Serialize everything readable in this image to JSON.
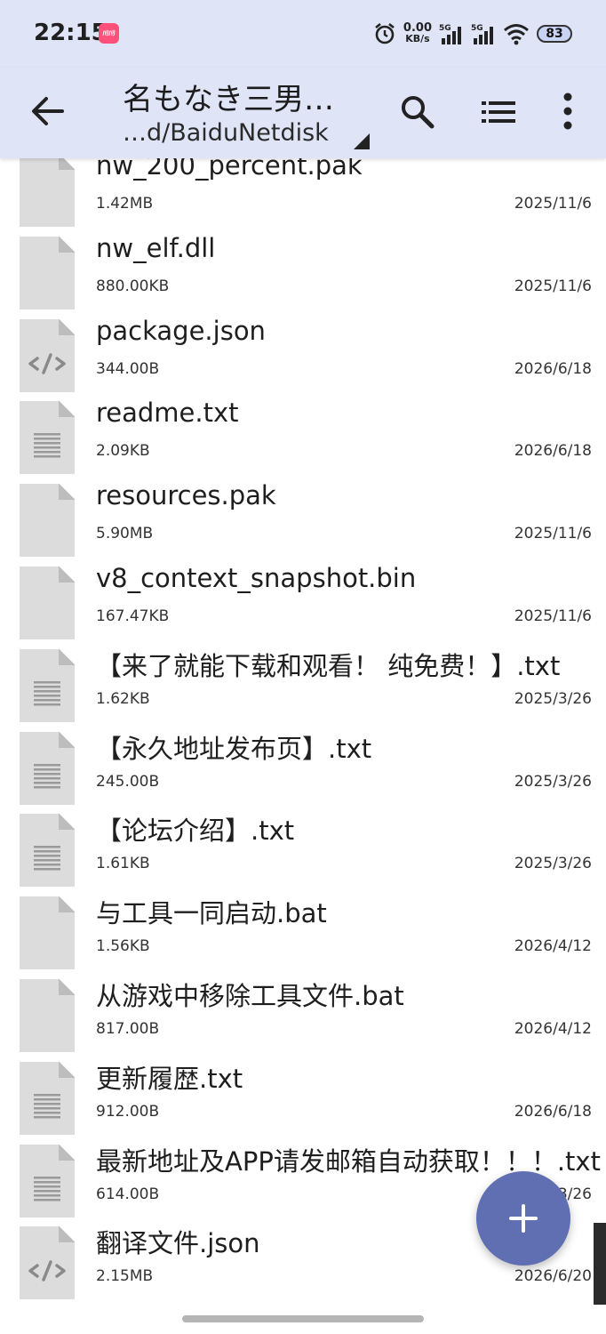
{
  "status_bar": {
    "time": "22:15",
    "app_badge": "ﾊﾘﾊﾘ",
    "net_speed_value": "0.00",
    "net_speed_unit": "KB/s",
    "signal_1_label": "5G",
    "signal_2_label": "5G",
    "battery": "83"
  },
  "toolbar": {
    "title": "名もなき三男…",
    "path": "…d/BaiduNetdisk"
  },
  "files": [
    {
      "name": "nw_200_percent.pak",
      "size": "1.42MB",
      "date": "2025/11/6",
      "icon": "file-generic-icon"
    },
    {
      "name": "nw_elf.dll",
      "size": "880.00KB",
      "date": "2025/11/6",
      "icon": "file-generic-icon"
    },
    {
      "name": "package.json",
      "size": "344.00B",
      "date": "2026/6/18",
      "icon": "file-code-icon"
    },
    {
      "name": "readme.txt",
      "size": "2.09KB",
      "date": "2026/6/18",
      "icon": "file-text-icon"
    },
    {
      "name": "resources.pak",
      "size": "5.90MB",
      "date": "2025/11/6",
      "icon": "file-generic-icon"
    },
    {
      "name": "v8_context_snapshot.bin",
      "size": "167.47KB",
      "date": "2025/11/6",
      "icon": "file-generic-icon"
    },
    {
      "name": "【来了就能下载和观看！ 纯免费！】.txt",
      "size": "1.62KB",
      "date": "2025/3/26",
      "icon": "file-text-icon"
    },
    {
      "name": "【永久地址发布页】.txt",
      "size": "245.00B",
      "date": "2025/3/26",
      "icon": "file-text-icon"
    },
    {
      "name": "【论坛介绍】.txt",
      "size": "1.61KB",
      "date": "2025/3/26",
      "icon": "file-text-icon"
    },
    {
      "name": "与工具一同启动.bat",
      "size": "1.56KB",
      "date": "2026/4/12",
      "icon": "file-generic-icon"
    },
    {
      "name": "从游戏中移除工具文件.bat",
      "size": "817.00B",
      "date": "2026/4/12",
      "icon": "file-generic-icon"
    },
    {
      "name": "更新履歴.txt",
      "size": "912.00B",
      "date": "2026/6/18",
      "icon": "file-text-icon"
    },
    {
      "name": "最新地址及APP请发邮箱自动获取！！！.txt",
      "size": "614.00B",
      "date": "2025/3/26",
      "icon": "file-text-icon"
    },
    {
      "name": "翻译文件.json",
      "size": "2.15MB",
      "date": "2026/6/20",
      "icon": "file-code-icon"
    }
  ],
  "colors": {
    "header_bg": "#dfe4f7",
    "fab": "#5f6fb2",
    "file_icon": "#dcdcdc"
  }
}
